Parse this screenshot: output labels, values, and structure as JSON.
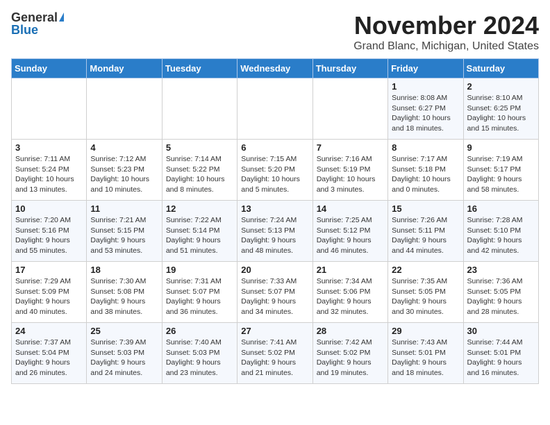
{
  "header": {
    "logo_general": "General",
    "logo_blue": "Blue",
    "month": "November 2024",
    "location": "Grand Blanc, Michigan, United States"
  },
  "days_of_week": [
    "Sunday",
    "Monday",
    "Tuesday",
    "Wednesday",
    "Thursday",
    "Friday",
    "Saturday"
  ],
  "weeks": [
    [
      {
        "day": "",
        "info": ""
      },
      {
        "day": "",
        "info": ""
      },
      {
        "day": "",
        "info": ""
      },
      {
        "day": "",
        "info": ""
      },
      {
        "day": "",
        "info": ""
      },
      {
        "day": "1",
        "info": "Sunrise: 8:08 AM\nSunset: 6:27 PM\nDaylight: 10 hours and 18 minutes."
      },
      {
        "day": "2",
        "info": "Sunrise: 8:10 AM\nSunset: 6:25 PM\nDaylight: 10 hours and 15 minutes."
      }
    ],
    [
      {
        "day": "3",
        "info": "Sunrise: 7:11 AM\nSunset: 5:24 PM\nDaylight: 10 hours and 13 minutes."
      },
      {
        "day": "4",
        "info": "Sunrise: 7:12 AM\nSunset: 5:23 PM\nDaylight: 10 hours and 10 minutes."
      },
      {
        "day": "5",
        "info": "Sunrise: 7:14 AM\nSunset: 5:22 PM\nDaylight: 10 hours and 8 minutes."
      },
      {
        "day": "6",
        "info": "Sunrise: 7:15 AM\nSunset: 5:20 PM\nDaylight: 10 hours and 5 minutes."
      },
      {
        "day": "7",
        "info": "Sunrise: 7:16 AM\nSunset: 5:19 PM\nDaylight: 10 hours and 3 minutes."
      },
      {
        "day": "8",
        "info": "Sunrise: 7:17 AM\nSunset: 5:18 PM\nDaylight: 10 hours and 0 minutes."
      },
      {
        "day": "9",
        "info": "Sunrise: 7:19 AM\nSunset: 5:17 PM\nDaylight: 9 hours and 58 minutes."
      }
    ],
    [
      {
        "day": "10",
        "info": "Sunrise: 7:20 AM\nSunset: 5:16 PM\nDaylight: 9 hours and 55 minutes."
      },
      {
        "day": "11",
        "info": "Sunrise: 7:21 AM\nSunset: 5:15 PM\nDaylight: 9 hours and 53 minutes."
      },
      {
        "day": "12",
        "info": "Sunrise: 7:22 AM\nSunset: 5:14 PM\nDaylight: 9 hours and 51 minutes."
      },
      {
        "day": "13",
        "info": "Sunrise: 7:24 AM\nSunset: 5:13 PM\nDaylight: 9 hours and 48 minutes."
      },
      {
        "day": "14",
        "info": "Sunrise: 7:25 AM\nSunset: 5:12 PM\nDaylight: 9 hours and 46 minutes."
      },
      {
        "day": "15",
        "info": "Sunrise: 7:26 AM\nSunset: 5:11 PM\nDaylight: 9 hours and 44 minutes."
      },
      {
        "day": "16",
        "info": "Sunrise: 7:28 AM\nSunset: 5:10 PM\nDaylight: 9 hours and 42 minutes."
      }
    ],
    [
      {
        "day": "17",
        "info": "Sunrise: 7:29 AM\nSunset: 5:09 PM\nDaylight: 9 hours and 40 minutes."
      },
      {
        "day": "18",
        "info": "Sunrise: 7:30 AM\nSunset: 5:08 PM\nDaylight: 9 hours and 38 minutes."
      },
      {
        "day": "19",
        "info": "Sunrise: 7:31 AM\nSunset: 5:07 PM\nDaylight: 9 hours and 36 minutes."
      },
      {
        "day": "20",
        "info": "Sunrise: 7:33 AM\nSunset: 5:07 PM\nDaylight: 9 hours and 34 minutes."
      },
      {
        "day": "21",
        "info": "Sunrise: 7:34 AM\nSunset: 5:06 PM\nDaylight: 9 hours and 32 minutes."
      },
      {
        "day": "22",
        "info": "Sunrise: 7:35 AM\nSunset: 5:05 PM\nDaylight: 9 hours and 30 minutes."
      },
      {
        "day": "23",
        "info": "Sunrise: 7:36 AM\nSunset: 5:05 PM\nDaylight: 9 hours and 28 minutes."
      }
    ],
    [
      {
        "day": "24",
        "info": "Sunrise: 7:37 AM\nSunset: 5:04 PM\nDaylight: 9 hours and 26 minutes."
      },
      {
        "day": "25",
        "info": "Sunrise: 7:39 AM\nSunset: 5:03 PM\nDaylight: 9 hours and 24 minutes."
      },
      {
        "day": "26",
        "info": "Sunrise: 7:40 AM\nSunset: 5:03 PM\nDaylight: 9 hours and 23 minutes."
      },
      {
        "day": "27",
        "info": "Sunrise: 7:41 AM\nSunset: 5:02 PM\nDaylight: 9 hours and 21 minutes."
      },
      {
        "day": "28",
        "info": "Sunrise: 7:42 AM\nSunset: 5:02 PM\nDaylight: 9 hours and 19 minutes."
      },
      {
        "day": "29",
        "info": "Sunrise: 7:43 AM\nSunset: 5:01 PM\nDaylight: 9 hours and 18 minutes."
      },
      {
        "day": "30",
        "info": "Sunrise: 7:44 AM\nSunset: 5:01 PM\nDaylight: 9 hours and 16 minutes."
      }
    ]
  ]
}
